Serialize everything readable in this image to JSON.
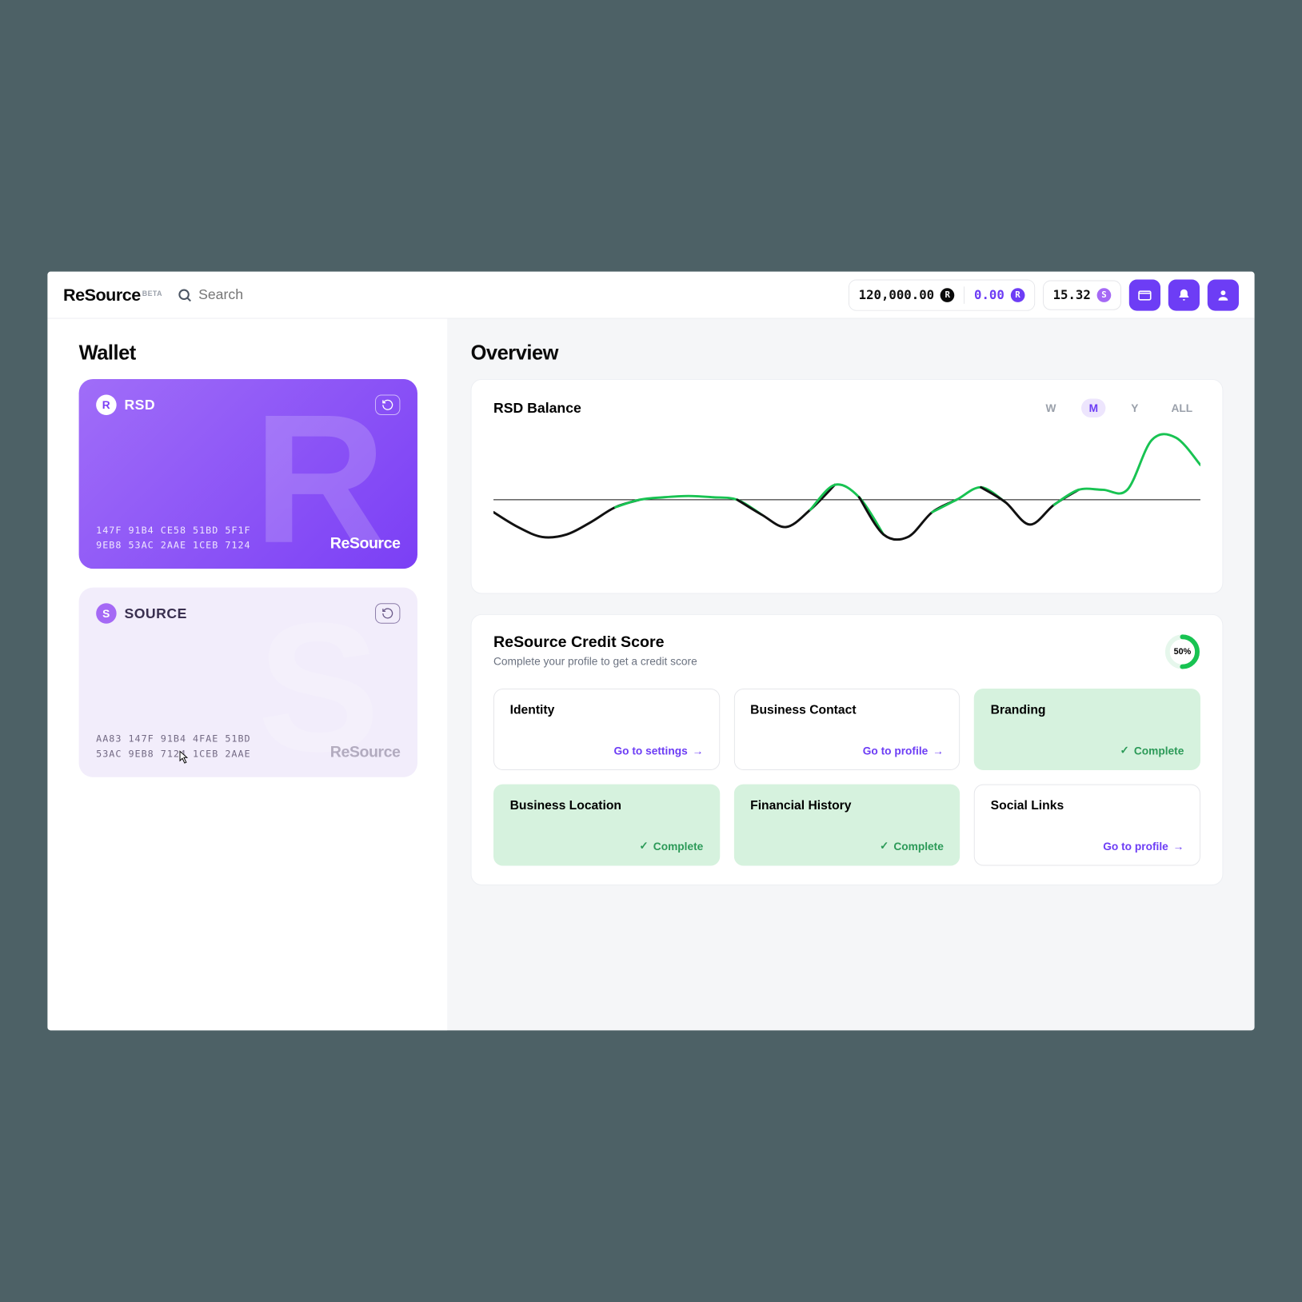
{
  "brand": {
    "name": "ReSource",
    "badge": "BETA"
  },
  "search": {
    "placeholder": "Search"
  },
  "header": {
    "balance1": "120,000.00",
    "balance2": "0.00",
    "balance3": "15.32"
  },
  "sidebar": {
    "title": "Wallet",
    "cards": [
      {
        "symbol": "RSD",
        "glyph": "R",
        "hash": "147F 91B4 CE58 51BD 5F1F\n9EB8 53AC 2AAE 1CEB 7124",
        "brand": "ReSource"
      },
      {
        "symbol": "SOURCE",
        "glyph": "S",
        "hash": "AA83 147F 91B4 4FAE 51BD\n53AC 9EB8 7124 1CEB 2AAE",
        "brand": "ReSource"
      }
    ]
  },
  "main": {
    "title": "Overview",
    "balance_panel": {
      "title": "RSD Balance",
      "periods": [
        "W",
        "M",
        "Y",
        "ALL"
      ],
      "active_period": "M"
    },
    "credit_panel": {
      "title": "ReSource Credit Score",
      "subtitle": "Complete your profile to get a credit score",
      "progress_pct": "50%",
      "tiles": [
        {
          "title": "Identity",
          "status": "link",
          "action": "Go to settings"
        },
        {
          "title": "Business Contact",
          "status": "link",
          "action": "Go to profile"
        },
        {
          "title": "Branding",
          "status": "done",
          "action": "Complete"
        },
        {
          "title": "Business Location",
          "status": "done",
          "action": "Complete"
        },
        {
          "title": "Financial History",
          "status": "done",
          "action": "Complete"
        },
        {
          "title": "Social Links",
          "status": "link",
          "action": "Go to profile"
        }
      ]
    }
  },
  "chart_data": {
    "type": "line",
    "title": "RSD Balance",
    "xlabel": "",
    "ylabel": "",
    "x": [
      0,
      1,
      2,
      3,
      4,
      5,
      6,
      7,
      8,
      9,
      10,
      11,
      12,
      13,
      14,
      15,
      16,
      17,
      18,
      19,
      20,
      21,
      22,
      23,
      24,
      25,
      26,
      27,
      28,
      29
    ],
    "values": [
      -10,
      -22,
      -30,
      -28,
      -18,
      -6,
      0,
      2,
      3,
      2,
      0,
      -12,
      -22,
      -8,
      12,
      2,
      -28,
      -30,
      -10,
      0,
      10,
      -2,
      -20,
      -4,
      8,
      8,
      8,
      48,
      50,
      28
    ],
    "baseline": 0,
    "ylim": [
      -60,
      60
    ],
    "positive_color": "#18c352",
    "negative_color": "#111111"
  }
}
